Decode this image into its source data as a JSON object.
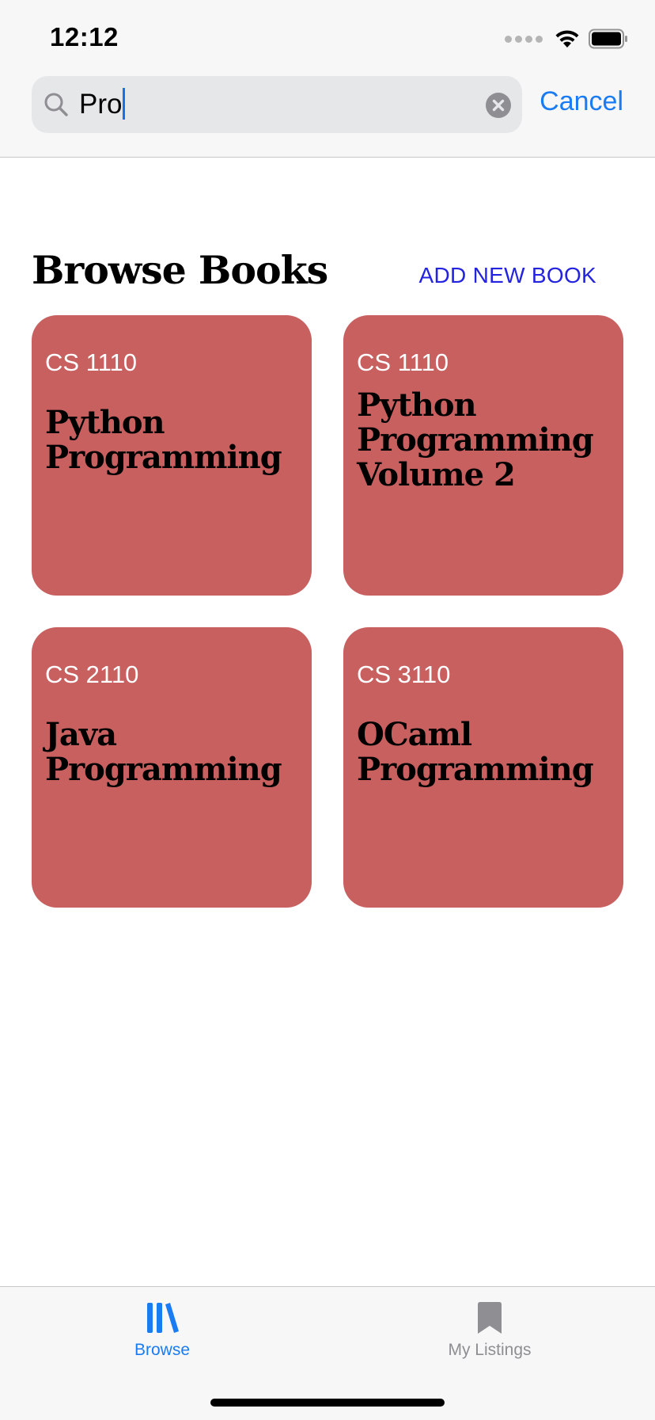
{
  "status_bar": {
    "time": "12:12"
  },
  "search": {
    "query": "Pro",
    "cancel_label": "Cancel"
  },
  "browse": {
    "title": "Browse Books",
    "add_label": "ADD NEW BOOK",
    "books": [
      {
        "course": "CS 1110",
        "title": "Python Programming"
      },
      {
        "course": "CS 1110",
        "title": "Python Programming Volume 2"
      },
      {
        "course": "CS 2110",
        "title": "Java Programming"
      },
      {
        "course": "CS 3110",
        "title": "OCaml Programming"
      }
    ]
  },
  "tabs": [
    {
      "label": "Browse",
      "icon": "books-icon",
      "active": true
    },
    {
      "label": "My Listings",
      "icon": "bookmark-icon",
      "active": false
    }
  ],
  "colors": {
    "accent": "#1a7cf2",
    "card": "#c96060",
    "add_link": "#2323e0",
    "inactive_tab": "#8e8e93"
  }
}
